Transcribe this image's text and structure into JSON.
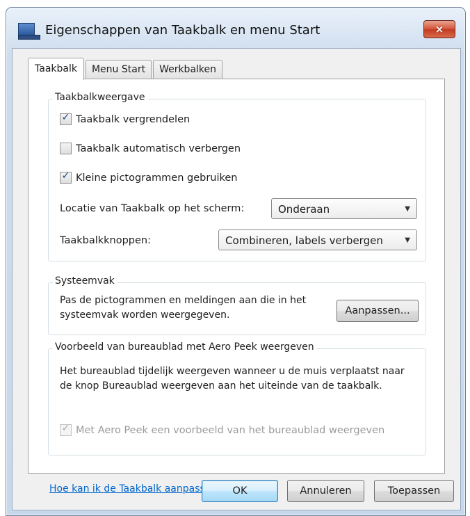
{
  "window": {
    "title": "Eigenschappen van Taakbalk en menu Start",
    "close_glyph": "×"
  },
  "tabs": [
    {
      "label": "Taakbalk",
      "active": true
    },
    {
      "label": "Menu Start",
      "active": false
    },
    {
      "label": "Werkbalken",
      "active": false
    }
  ],
  "taskbar_appearance": {
    "title": "Taakbalkweergave",
    "lock_taskbar": {
      "label": "Taakbalk vergrendelen",
      "checked": true
    },
    "auto_hide": {
      "label": "Taakbalk automatisch verbergen",
      "checked": false
    },
    "small_icons": {
      "label": "Kleine pictogrammen gebruiken",
      "checked": true
    },
    "location_label": "Locatie van Taakbalk op het scherm:",
    "location_value": "Onderaan",
    "buttons_label": "Taakbalkknoppen:",
    "buttons_value": "Combineren, labels verbergen",
    "tick": "✓",
    "dropdown_arrow": "▼"
  },
  "notification_area": {
    "title": "Systeemvak",
    "description_line1": "Pas de pictogrammen en meldingen aan die in het",
    "description_line2": "systeemvak worden weergegeven.",
    "customize_label": "Aanpassen..."
  },
  "aero_peek": {
    "title": "Voorbeeld van bureaublad met Aero Peek weergeven",
    "description_line1": "Het bureaublad tijdelijk weergeven wanneer u de muis verplaatst naar",
    "description_line2": "de knop Bureaublad weergeven aan het uiteinde van de taakbalk.",
    "checkbox_label": "Met Aero Peek een voorbeeld van het bureaublad weergeven",
    "checked": true,
    "disabled": true
  },
  "help_link": "Hoe kan ik de Taakbalk aanpassen?",
  "footer": {
    "ok_label": "OK",
    "cancel_label": "Annuleren",
    "apply_label": "Toepassen"
  },
  "icons": {
    "app": "taskbar-icon",
    "close": "close-icon",
    "dropdown": "chevron-down-icon",
    "check": "checkmark-icon"
  }
}
